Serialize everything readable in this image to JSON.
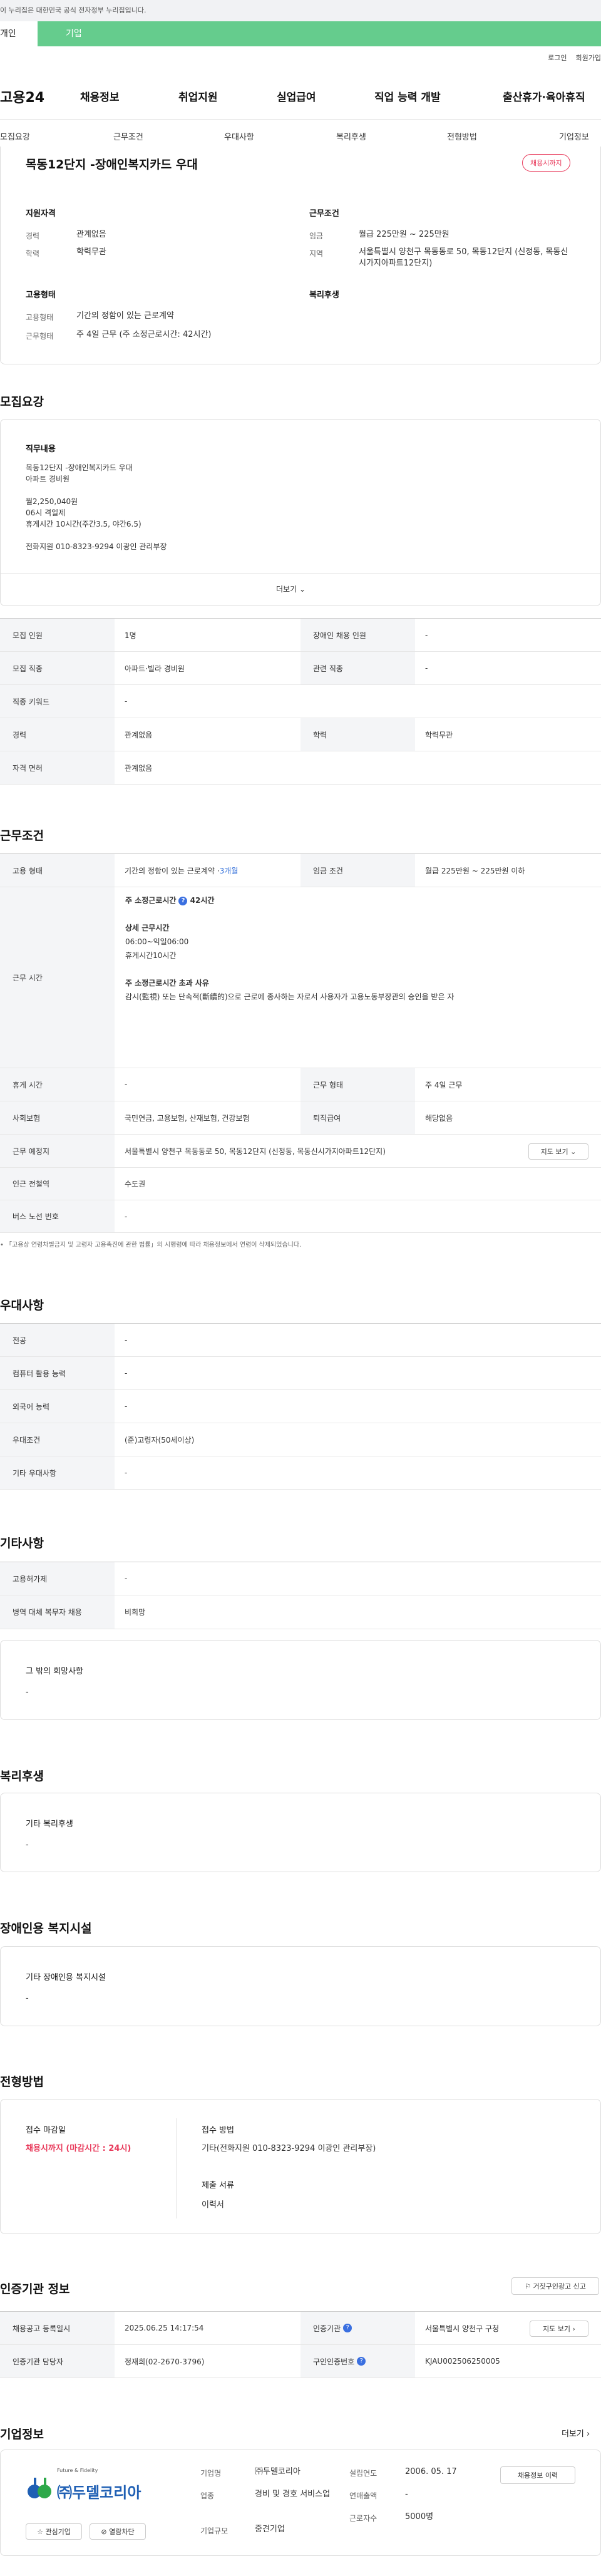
{
  "notice": "이 누리집은 대한민국 공식 전자정부 누리집입니다.",
  "user_tabs": {
    "personal": "개인",
    "company": "기업"
  },
  "util": {
    "login": "로그인",
    "join": "회원가입"
  },
  "logo": "고용24",
  "gnb": [
    "채용정보",
    "취업지원",
    "실업급여",
    "직업 능력 개발",
    "출산휴가·육아휴직"
  ],
  "subnav": [
    "모집요강",
    "근무조건",
    "우대사항",
    "복리후생",
    "전형방법",
    "기업정보"
  ],
  "job": {
    "title": "목동12단지 -장애인복지카드 우대",
    "status_badge": "채용시까지",
    "qual_title": "지원자격",
    "cond_title": "근무조건",
    "emp_title": "고용형태",
    "welfare_title": "복리후생",
    "career_label": "경력",
    "career_value": "관계없음",
    "edu_label": "학력",
    "edu_value": "학력무관",
    "wage_label": "임금",
    "wage_value": "월급 225만원 ~ 225만원",
    "loc_label": "지역",
    "loc_value": "서울특별시 양천구 목동동로 50, 목동12단지 (신정동, 목동신시가지아파트12단지)",
    "emptype_label": "고용형태",
    "emptype_value": "기간의 정함이 있는 근로계약",
    "worktype_label": "근무형태",
    "worktype_value": "주 4일 근무 (주 소정근로시간: 42시간)"
  },
  "recruit": {
    "section": "모집요강",
    "duty_title": "직무내용",
    "duty_lines": [
      "목동12단지 -장애인복지카드 우대",
      "아파트 경비원",
      "",
      "월2,250,040원",
      "06시 격일제",
      "휴게시간 10시간(주간3.5, 야간6.5)",
      "",
      "전화지원 010-8323-9294 이광인 관리부장"
    ],
    "more": "더보기",
    "rows": [
      {
        "l1": "모집 인원",
        "v1": "1명",
        "l2": "장애인 채용 인원",
        "v2": "-"
      },
      {
        "l1": "모집 직종",
        "v1": "아파트·빌라 경비원",
        "l2": "관련 직종",
        "v2": "-"
      },
      {
        "l1": "직종 키워드",
        "v1": "-"
      },
      {
        "l1": "경력",
        "v1": "관계없음",
        "l2": "학력",
        "v2": "학력무관"
      },
      {
        "l1": "자격 면허",
        "v1": "관계없음"
      }
    ]
  },
  "work": {
    "section": "근무조건",
    "emptype_label": "고용 형태",
    "emptype_value": "기간의 정함이 있는 근로계약 · ",
    "emptype_period": "3개월",
    "wage_label": "임금 조건",
    "wage_value": "월급 225만원 ~ 225만원 이하",
    "hours_label": "근무 시간",
    "hours_title": "주 소정근로시간",
    "hours_value": "42시간",
    "detail_title": "상세 근무시간",
    "detail_lines": [
      "06:00~익일06:00",
      "휴게시간10시간"
    ],
    "over_title": "주 소정근로시간 초과 사유",
    "over_text": "감시(監視) 또는 단속적(斷續的)으로 근로에 종사하는 자로서 사용자가 고용노동부장관의 승인을 받은 자",
    "break_label": "휴게 시간",
    "break_value": "-",
    "form_label": "근무 형태",
    "form_value": "주 4일 근무",
    "ins_label": "사회보험",
    "ins_value": "국민연금, 고용보험, 산재보험, 건강보험",
    "retire_label": "퇴직급여",
    "retire_value": "해당없음",
    "place_label": "근무 예정지",
    "place_value": "서울특별시 양천구 목동동로 50, 목동12단지 (신정동, 목동신시가지아파트12단지)",
    "map_btn": "지도 보기",
    "subway_label": "인근 전철역",
    "subway_value": "수도권",
    "bus_label": "버스 노선 번호",
    "bus_value": "-",
    "footnote": "「고용상 연령차별금지 및 고령자 고용촉진에 관한 법률」의 시행령에 따라 채용정보에서 연령이 삭제되었습니다."
  },
  "pref": {
    "section": "우대사항",
    "rows": [
      {
        "l": "전공",
        "v": "-"
      },
      {
        "l": "컴퓨터 활용 능력",
        "v": "-"
      },
      {
        "l": "외국어 능력",
        "v": "-"
      },
      {
        "l": "우대조건",
        "v": "(준)고령자(50세이상)"
      },
      {
        "l": "기타 우대사항",
        "v": "-"
      }
    ]
  },
  "etc": {
    "section": "기타사항",
    "rows": [
      {
        "l": "고용허가제",
        "v": "-"
      },
      {
        "l": "병역 대체 복무자 채용",
        "v": "비희망"
      }
    ],
    "hope_title": "그 밖의 희망사항",
    "hope_value": "-"
  },
  "welfare": {
    "section": "복리후생",
    "title": "기타 복리후생",
    "value": "-"
  },
  "disabled": {
    "section": "장애인용 복지시설",
    "title": "기타 장애인용 복지시설",
    "value": "-"
  },
  "screening": {
    "section": "전형방법",
    "deadline_title": "접수 마감일",
    "deadline_value": "채용시까지 (마감시간 : 24시)",
    "method_title": "접수 방법",
    "method_value": "기타(전화지원 010-8323-9294 이광인 관리부장)",
    "docs_title": "제출 서류",
    "docs_value": "이력서"
  },
  "agency": {
    "section": "인증기관 정보",
    "report_btn": "거짓구인광고 신고",
    "reg_label": "채용공고 등록일시",
    "reg_value": "2025.06.25 14:17:54",
    "org_label": "인증기관",
    "org_value": "서울특별시 양천구 구청",
    "map_btn": "지도 보기",
    "mgr_label": "인증기관 담당자",
    "mgr_value": "정재희(02-2670-3796)",
    "num_label": "구인인증번호",
    "num_value": "KJAU002506250005"
  },
  "company": {
    "section": "기업정보",
    "more": "더보기",
    "logo_top": "Future & Fidelity",
    "logo_name": "㈜두델코리아",
    "fav_btn": "관심기업",
    "block_btn": "열람차단",
    "name_label": "기업명",
    "name_value": "㈜두델코리아",
    "ind_label": "업종",
    "ind_value": "경비 및 경호 서비스업",
    "size_label": "기업규모",
    "size_value": "중견기업",
    "est_label": "설립연도",
    "est_value": "2006. 05. 17",
    "sales_label": "연매출액",
    "sales_value": "-",
    "staff_label": "근로자수",
    "staff_value": "5000명",
    "jobs_btn": "채용정보 이력"
  }
}
